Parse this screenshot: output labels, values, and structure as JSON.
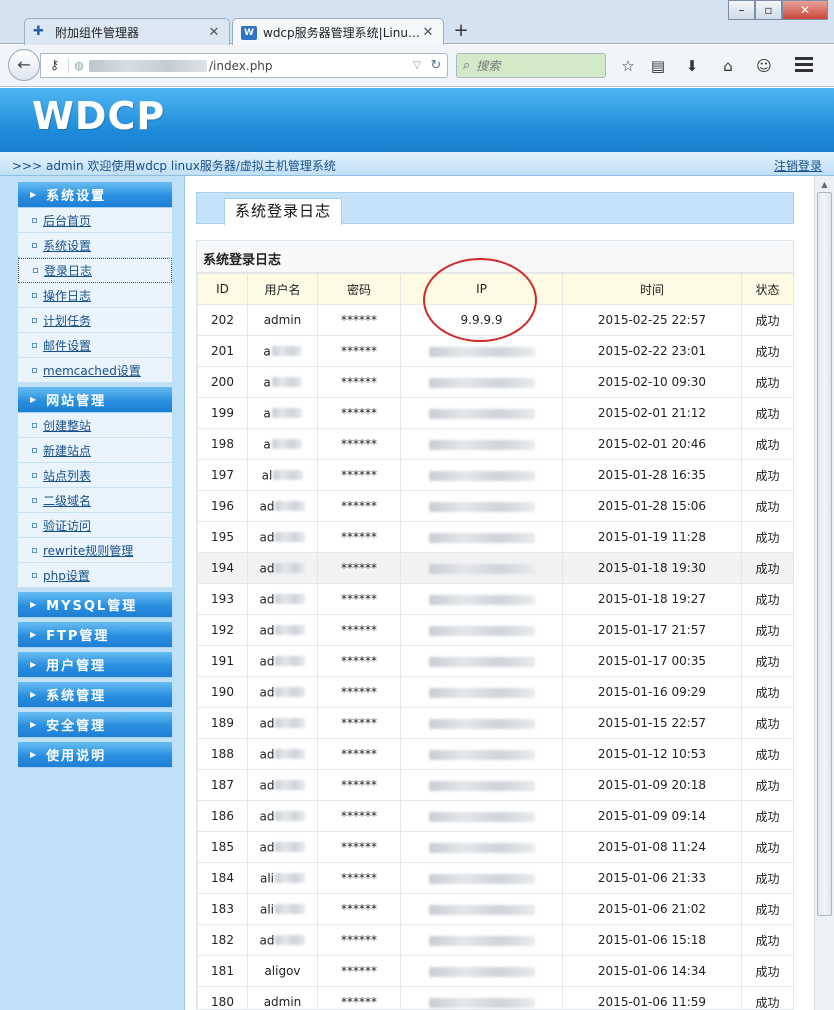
{
  "browser": {
    "tabs": [
      {
        "title": "附加组件管理器",
        "icon": "puzzle-icon"
      },
      {
        "title": "wdcp服务器管理系统|Linu…",
        "icon": "wdcp-icon"
      }
    ],
    "url": "/index.php",
    "search_placeholder": "搜索",
    "window_controls": {
      "minimize": "–",
      "restore": "▫",
      "close": "✕"
    }
  },
  "app": {
    "logo": "WDCP",
    "welcome": ">>> admin 欢迎使用wdcp linux服务器/虚拟主机管理系统",
    "logout": "注销登录",
    "accent": "#1d8ad9"
  },
  "sidebar": {
    "system_settings": {
      "title": "系统设置",
      "items": [
        "后台首页",
        "系统设置",
        "登录日志",
        "操作日志",
        "计划任务",
        "邮件设置",
        "memcached设置"
      ],
      "active": "登录日志"
    },
    "site_management": {
      "title": "网站管理",
      "items": [
        "创建整站",
        "新建站点",
        "站点列表",
        "二级域名",
        "验证访问",
        "rewrite规则管理",
        "php设置"
      ]
    },
    "collapsed": [
      "MYSQL管理",
      "FTP管理",
      "用户管理",
      "系统管理",
      "安全管理",
      "使用说明"
    ]
  },
  "content": {
    "tab_title": "系统登录日志",
    "panel_title": "系统登录日志",
    "columns": [
      "ID",
      "用户名",
      "密码",
      "IP",
      "时间",
      "状态"
    ],
    "rows": [
      {
        "id": "202",
        "user": "admin",
        "user_prefix": "",
        "pw": "******",
        "ip": "9.9.9.9",
        "time": "2015-02-25 22:57",
        "status": "成功"
      },
      {
        "id": "201",
        "user": "",
        "user_prefix": "a",
        "pw": "******",
        "ip": "",
        "time": "2015-02-22 23:01",
        "status": "成功"
      },
      {
        "id": "200",
        "user": "",
        "user_prefix": "a",
        "pw": "******",
        "ip": "",
        "time": "2015-02-10 09:30",
        "status": "成功"
      },
      {
        "id": "199",
        "user": "",
        "user_prefix": "a",
        "pw": "******",
        "ip": "",
        "time": "2015-02-01 21:12",
        "status": "成功"
      },
      {
        "id": "198",
        "user": "",
        "user_prefix": "a",
        "pw": "******",
        "ip": "",
        "time": "2015-02-01 20:46",
        "status": "成功"
      },
      {
        "id": "197",
        "user": "",
        "user_prefix": "al",
        "pw": "******",
        "ip": "",
        "time": "2015-01-28 16:35",
        "status": "成功"
      },
      {
        "id": "196",
        "user": "",
        "user_prefix": "ad",
        "pw": "******",
        "ip": "",
        "time": "2015-01-28 15:06",
        "status": "成功"
      },
      {
        "id": "195",
        "user": "",
        "user_prefix": "ad",
        "pw": "******",
        "ip": "",
        "time": "2015-01-19 11:28",
        "status": "成功"
      },
      {
        "id": "194",
        "user": "",
        "user_prefix": "ad",
        "pw": "******",
        "ip": "",
        "time": "2015-01-18 19:30",
        "status": "成功"
      },
      {
        "id": "193",
        "user": "",
        "user_prefix": "ad",
        "pw": "******",
        "ip": "",
        "time": "2015-01-18 19:27",
        "status": "成功"
      },
      {
        "id": "192",
        "user": "",
        "user_prefix": "ad",
        "pw": "******",
        "ip": "",
        "time": "2015-01-17 21:57",
        "status": "成功"
      },
      {
        "id": "191",
        "user": "",
        "user_prefix": "ad",
        "pw": "******",
        "ip": "",
        "time": "2015-01-17 00:35",
        "status": "成功"
      },
      {
        "id": "190",
        "user": "",
        "user_prefix": "ad",
        "pw": "******",
        "ip": "",
        "time": "2015-01-16 09:29",
        "status": "成功"
      },
      {
        "id": "189",
        "user": "",
        "user_prefix": "ad",
        "pw": "******",
        "ip": "",
        "time": "2015-01-15 22:57",
        "status": "成功"
      },
      {
        "id": "188",
        "user": "",
        "user_prefix": "ad",
        "pw": "******",
        "ip": "",
        "time": "2015-01-12 10:53",
        "status": "成功"
      },
      {
        "id": "187",
        "user": "",
        "user_prefix": "ad",
        "pw": "******",
        "ip": "",
        "time": "2015-01-09 20:18",
        "status": "成功"
      },
      {
        "id": "186",
        "user": "",
        "user_prefix": "ad",
        "pw": "******",
        "ip": "",
        "time": "2015-01-09 09:14",
        "status": "成功"
      },
      {
        "id": "185",
        "user": "",
        "user_prefix": "ad",
        "pw": "******",
        "ip": "",
        "time": "2015-01-08 11:24",
        "status": "成功"
      },
      {
        "id": "184",
        "user": "",
        "user_prefix": "ali",
        "pw": "******",
        "ip": "",
        "time": "2015-01-06 21:33",
        "status": "成功"
      },
      {
        "id": "183",
        "user": "",
        "user_prefix": "ali",
        "pw": "******",
        "ip": "",
        "time": "2015-01-06 21:02",
        "status": "成功"
      },
      {
        "id": "182",
        "user": "",
        "user_prefix": "ad",
        "pw": "******",
        "ip": "",
        "time": "2015-01-06 15:18",
        "status": "成功"
      },
      {
        "id": "181",
        "user": "aligov",
        "user_prefix": "",
        "pw": "******",
        "ip": "",
        "time": "2015-01-06 14:34",
        "status": "成功"
      },
      {
        "id": "180",
        "user": "admin",
        "user_prefix": "",
        "pw": "******",
        "ip": "",
        "time": "2015-01-06 11:59",
        "status": "成功"
      }
    ],
    "highlighted_row": "194",
    "annotation_color": "#d12a2a"
  }
}
